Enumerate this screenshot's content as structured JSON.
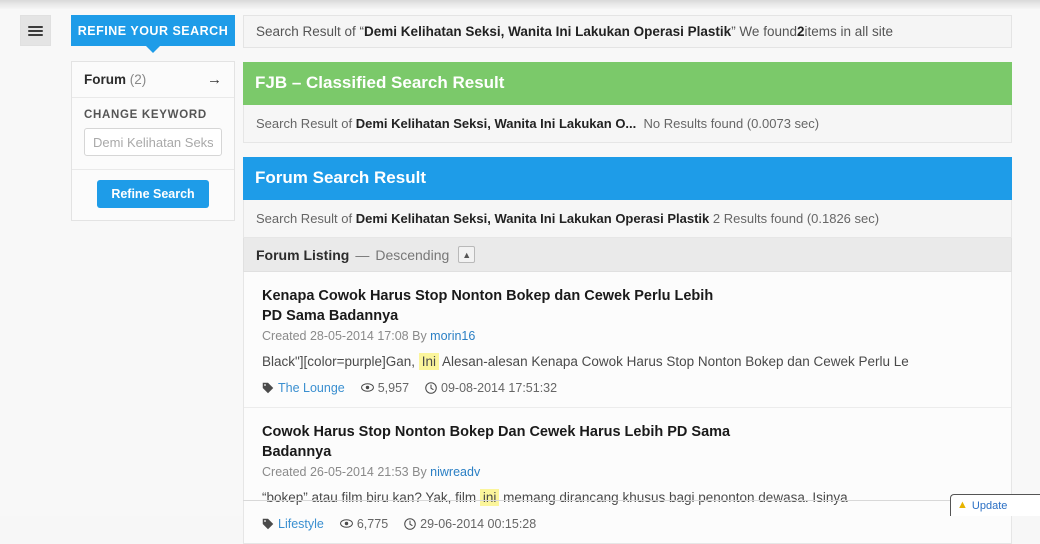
{
  "menu": {
    "icon": "hamburger-icon"
  },
  "sidebar": {
    "refine_tab_label": "REFINE YOUR SEARCH",
    "forum_label": "Forum",
    "forum_count": "(2)",
    "arrow_icon": "→",
    "change_keyword_label": "CHANGE KEYWORD",
    "keyword_value": "",
    "keyword_placeholder": "Demi Kelihatan Seks",
    "refine_button_label": "Refine Search"
  },
  "topbar": {
    "prefix": "Search Result of “",
    "query": "Demi Kelihatan Seksi, Wanita Ini Lakukan Operasi Plastik",
    "middle": "” We found ",
    "count": "2",
    "suffix": " items in all site"
  },
  "fjb_panel": {
    "title": "FJB – Classified Search Result",
    "sub_prefix": "Search Result of ",
    "sub_query": "Demi Kelihatan Seksi, Wanita Ini Lakukan O...",
    "sub_result": "No Results found (0.0073 sec)",
    "color": "#7bc96a"
  },
  "forum_panel": {
    "title": "Forum Search Result",
    "sub_prefix": "Search Result of ",
    "sub_query": "Demi Kelihatan Seksi, Wanita Ini Lakukan Operasi Plastik",
    "sub_result": " 2 Results found (0.1826 sec)",
    "color": "#1e9ce8",
    "listing_label": "Forum Listing",
    "listing_dash": "—",
    "listing_sort": "Descending",
    "collapse_icon": "caret-up-icon"
  },
  "results": [
    {
      "title": "Kenapa Cowok Harus Stop Nonton Bokep dan Cewek Perlu Lebih PD Sama Badannya",
      "created_label": "Created 28-05-2014 17:08 By ",
      "author": "morin16",
      "snippet_before": "Black\"][color=purple]Gan, ",
      "snippet_highlight": "Ini",
      "snippet_after": " Alesan-alesan Kenapa Cowok Harus Stop Nonton Bokep dan Cewek Perlu Le",
      "category": "The Lounge",
      "views": "5,957",
      "timestamp": "09-08-2014 17:51:32"
    },
    {
      "title": "Cowok Harus Stop Nonton Bokep Dan Cewek Harus Lebih PD Sama Badannya",
      "created_label": "Created 26-05-2014 21:53 By ",
      "author": "niwreadv",
      "snippet_before": "“bokep” atau film biru kan? Yak, film ",
      "snippet_highlight": "ini",
      "snippet_after": " memang dirancang khusus bagi penonton dewasa. Isinya",
      "category": "Lifestyle",
      "views": "6,775",
      "timestamp": "29-06-2014 00:15:28"
    }
  ],
  "corner_popup": {
    "warn_icon": "warning-triangle-icon",
    "text": "Update"
  }
}
